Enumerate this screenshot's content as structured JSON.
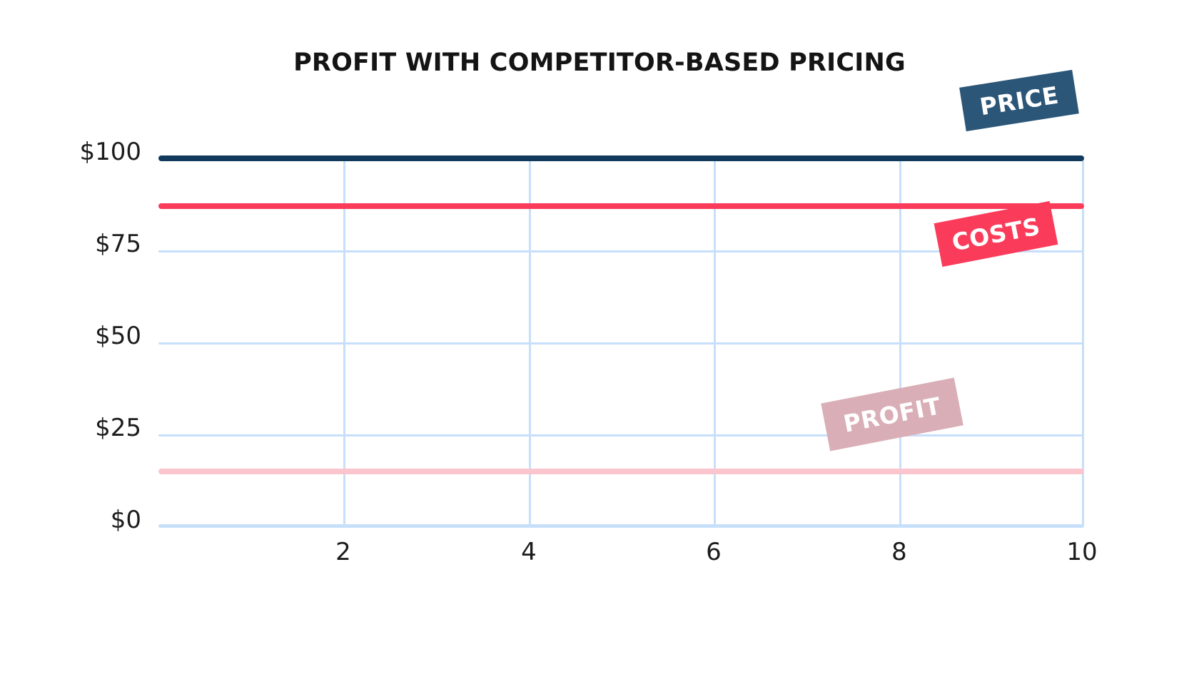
{
  "chart_data": {
    "type": "line",
    "title": "PROFIT WITH COMPETITOR-BASED PRICING",
    "xlabel": "",
    "ylabel": "",
    "x": [
      0,
      10
    ],
    "xlim": [
      0,
      10
    ],
    "ylim": [
      0,
      100
    ],
    "xticks": [
      "2",
      "4",
      "6",
      "8",
      "10"
    ],
    "xtick_values": [
      2,
      4,
      6,
      8,
      10
    ],
    "yticks": [
      "$0",
      "$25",
      "$50",
      "$75",
      "$100"
    ],
    "ytick_values": [
      0,
      25,
      50,
      75,
      100
    ],
    "grid": true,
    "legend_position": "inline-annotations",
    "series": [
      {
        "name": "PRICE",
        "values": [
          100,
          100
        ],
        "color": "#123a5c",
        "label_bg": "#2c5677",
        "label_text_color": "#ffffff"
      },
      {
        "name": "COSTS",
        "values": [
          87,
          87
        ],
        "color": "#fa3c5a",
        "label_bg": "#fa3c5a",
        "label_text_color": "#ffffff"
      },
      {
        "name": "PROFIT",
        "values": [
          15,
          15
        ],
        "color": "#fbc5cd",
        "label_bg": "#d9aeb7",
        "label_text_color": "#ffffff"
      }
    ],
    "annotations": [
      {
        "text": "PRICE",
        "series": "PRICE"
      },
      {
        "text": "COSTS",
        "series": "COSTS"
      },
      {
        "text": "PROFIT",
        "series": "PROFIT"
      }
    ],
    "colors": {
      "grid": "#c7dffa",
      "axis": "#c7dffa",
      "title": "#141414",
      "tick_label": "#1c1c1c",
      "background": "#ffffff"
    }
  }
}
